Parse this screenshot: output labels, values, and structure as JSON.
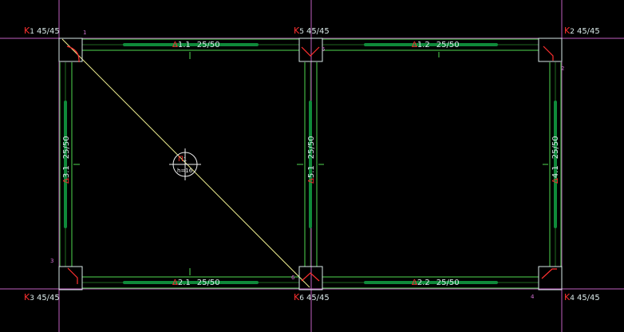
{
  "colors": {
    "background": "#000000",
    "grid_line": "#c060c0",
    "beam_outline": "#4fd84f",
    "beam_axis": "#2a8a2a",
    "reinforcement": "#0f8a3a",
    "column_outline": "#d8e8e8",
    "column_bracket": "#ff3030",
    "beam_label_prefix": "#ff3030",
    "beam_label_text": "#d8e8e8",
    "column_label_prefix": "#ff3030",
    "column_label_text": "#d8e8e8",
    "node_number": "#d070d0",
    "diagonal": "#f0f090",
    "slab_symbol": "#f0f0f0",
    "slab_label_prefix": "#ff3030"
  },
  "columns": [
    {
      "id": "k1",
      "prefix": "K",
      "index": "1",
      "size": "45/45"
    },
    {
      "id": "k5",
      "prefix": "K",
      "index": "5",
      "size": "45/45"
    },
    {
      "id": "k2",
      "prefix": "K",
      "index": "2",
      "size": "45/45"
    },
    {
      "id": "k3",
      "prefix": "K",
      "index": "3",
      "size": "45/45"
    },
    {
      "id": "k6",
      "prefix": "K",
      "index": "6",
      "size": "45/45"
    },
    {
      "id": "k4",
      "prefix": "K",
      "index": "4",
      "size": "45/45"
    }
  ],
  "beams": [
    {
      "id": "b11",
      "prefix": "Δ",
      "code": "1.1",
      "size": "25/50"
    },
    {
      "id": "b12",
      "prefix": "Δ",
      "code": "1.2",
      "size": "25/50"
    },
    {
      "id": "b21",
      "prefix": "Δ",
      "code": "2.1",
      "size": "25/50"
    },
    {
      "id": "b22",
      "prefix": "Δ",
      "code": "2.2",
      "size": "25/50"
    },
    {
      "id": "b31",
      "prefix": "Δ",
      "code": "3.1",
      "size": "25/50"
    },
    {
      "id": "b51",
      "prefix": "Δ",
      "code": "5.1",
      "size": "25/50"
    },
    {
      "id": "b41",
      "prefix": "Δ",
      "code": "4.1",
      "size": "25/50"
    }
  ],
  "slab": {
    "prefix": "Π",
    "index": "1",
    "thickness": "h=16"
  },
  "node_numbers": [
    "1",
    "5",
    "2",
    "3",
    "6",
    "4"
  ]
}
